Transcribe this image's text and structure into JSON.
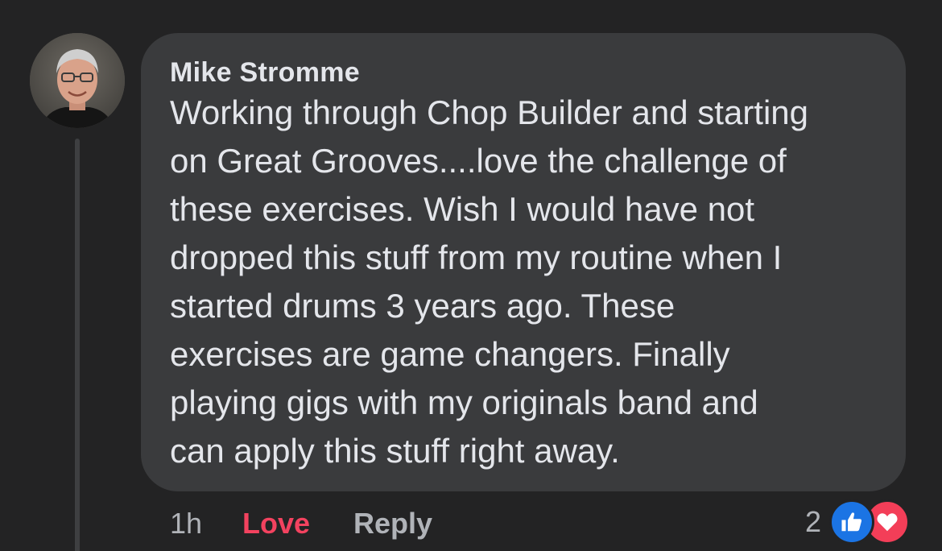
{
  "comment": {
    "author": "Mike Stromme",
    "text": "Working through Chop Builder and starting\non Great Grooves....love the challenge of\nthese exercises.  Wish I would have not\ndropped this stuff from my routine when I\nstarted drums 3 years ago.  These\nexercises are game changers.  Finally\nplaying gigs with my originals band and\ncan apply this stuff right away.",
    "time": "1h",
    "love_label": "Love",
    "reply_label": "Reply",
    "reaction_count": "2",
    "reaction_icons": [
      "like-icon",
      "heart-icon"
    ]
  },
  "colors": {
    "background": "#232324",
    "bubble": "#3a3b3d",
    "text": "#e4e6eb",
    "muted": "#b0b3b8",
    "love": "#f3425f",
    "like_blue": "#1b74e4",
    "heart_red": "#f33e58"
  }
}
